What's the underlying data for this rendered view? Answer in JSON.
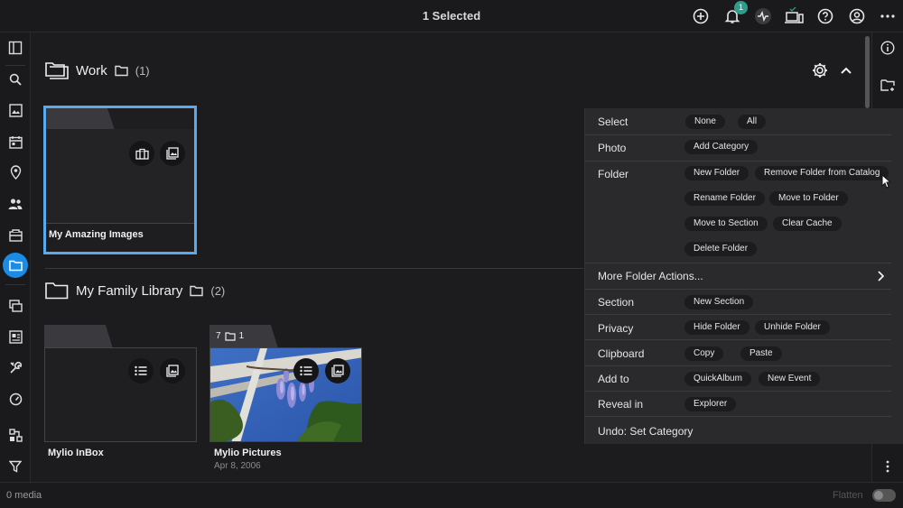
{
  "header": {
    "title": "1 Selected",
    "notification_count": "1"
  },
  "sidebar": {
    "items": [
      "sidebar-toggle",
      "search",
      "photos",
      "calendar",
      "map",
      "people",
      "events",
      "folders",
      "sources",
      "albums",
      "tools",
      "dashboard",
      "network",
      "filter"
    ]
  },
  "sections": [
    {
      "name": "Work",
      "count": "(1)"
    },
    {
      "name": "My Family Library",
      "count": "(2)"
    }
  ],
  "tiles": {
    "amazing": {
      "label": "My Amazing Images"
    },
    "inbox": {
      "label": "Mylio InBox"
    },
    "pictures": {
      "label": "Mylio Pictures",
      "date": "Apr 8, 2006",
      "photo_count": "7",
      "folder_count": "1"
    }
  },
  "menu": {
    "select": {
      "label": "Select",
      "none": "None",
      "all": "All"
    },
    "photo": {
      "label": "Photo",
      "add_category": "Add Category"
    },
    "folder": {
      "label": "Folder",
      "new_folder": "New Folder",
      "remove_folder": "Remove Folder from Catalog",
      "rename_folder": "Rename Folder",
      "move_to_folder": "Move to Folder",
      "move_to_section": "Move to Section",
      "clear_cache": "Clear Cache",
      "delete_folder": "Delete Folder"
    },
    "more": {
      "label": "More Folder Actions..."
    },
    "section": {
      "label": "Section",
      "new_section": "New Section"
    },
    "privacy": {
      "label": "Privacy",
      "hide_folder": "Hide Folder",
      "unhide_folder": "Unhide Folder"
    },
    "clipboard": {
      "label": "Clipboard",
      "copy": "Copy",
      "paste": "Paste"
    },
    "addto": {
      "label": "Add to",
      "quickalbum": "QuickAlbum",
      "new_event": "New Event"
    },
    "reveal": {
      "label": "Reveal in",
      "explorer": "Explorer"
    },
    "undo": {
      "label": "Undo: Set Category"
    }
  },
  "footer": {
    "media": "0 media",
    "flatten": "Flatten"
  }
}
